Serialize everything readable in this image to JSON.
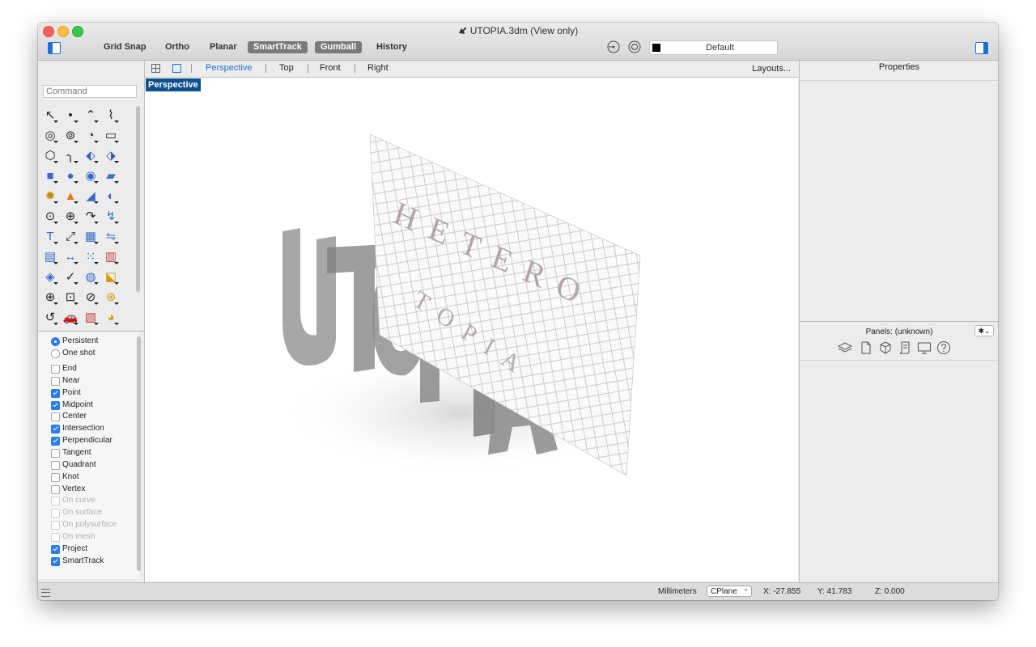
{
  "window": {
    "title": "UTOPIA.3dm (View only)"
  },
  "toolbar": {
    "modes": [
      {
        "label": "Grid Snap",
        "on": false
      },
      {
        "label": "Ortho",
        "on": false
      },
      {
        "label": "Planar",
        "on": false
      },
      {
        "label": "SmartTrack",
        "on": true
      },
      {
        "label": "Gumball",
        "on": true
      },
      {
        "label": "History",
        "on": false
      }
    ],
    "layer": "Default",
    "layer_color": "#000000"
  },
  "command": {
    "placeholder": "Command"
  },
  "tools": [
    "select-arrow-icon",
    "point-icon",
    "polyline-icon",
    "curve-icon",
    "circle-icon",
    "ellipse-icon",
    "arc-icon",
    "rectangle-icon",
    "polygon-icon",
    "fillet-curve-icon",
    "surface-from-points-icon",
    "sweep-surface-icon",
    "box-solid-icon",
    "sphere-icon",
    "cylinder-icon",
    "extrude-surface-icon",
    "gear-settings-icon",
    "trim-icon",
    "split-icon",
    "boolean-icon",
    "group-icon",
    "join-icon",
    "rebuild-icon",
    "edit-points-icon",
    "text-icon",
    "scale-icon",
    "array-icon",
    "mirror-icon",
    "block-icon",
    "dimension-icon",
    "grid-array-icon",
    "properties-icon",
    "render-icon",
    "check-icon",
    "analyze-icon",
    "paint-icon",
    "zoom-icon",
    "zoom-window-icon",
    "zoom-extents-icon",
    "zoom-selected-icon",
    "rotate-view-icon",
    "car-icon",
    "layout-icon",
    "shaded-icon"
  ],
  "osnaps": {
    "modes": [
      {
        "label": "Persistent",
        "selected": true
      },
      {
        "label": "One shot",
        "selected": false
      }
    ],
    "items": [
      {
        "label": "End",
        "checked": false,
        "enabled": true
      },
      {
        "label": "Near",
        "checked": false,
        "enabled": true
      },
      {
        "label": "Point",
        "checked": true,
        "enabled": true
      },
      {
        "label": "Midpoint",
        "checked": true,
        "enabled": true
      },
      {
        "label": "Center",
        "checked": false,
        "enabled": true
      },
      {
        "label": "Intersection",
        "checked": true,
        "enabled": true
      },
      {
        "label": "Perpendicular",
        "checked": true,
        "enabled": true
      },
      {
        "label": "Tangent",
        "checked": false,
        "enabled": true
      },
      {
        "label": "Quadrant",
        "checked": false,
        "enabled": true
      },
      {
        "label": "Knot",
        "checked": false,
        "enabled": true
      },
      {
        "label": "Vertex",
        "checked": false,
        "enabled": true
      },
      {
        "label": "On curve",
        "checked": false,
        "enabled": false
      },
      {
        "label": "On surface",
        "checked": false,
        "enabled": false
      },
      {
        "label": "On polysurface",
        "checked": false,
        "enabled": false
      },
      {
        "label": "On mesh",
        "checked": false,
        "enabled": false
      },
      {
        "label": "Project",
        "checked": true,
        "enabled": true
      },
      {
        "label": "SmartTrack",
        "checked": true,
        "enabled": true
      }
    ]
  },
  "viewports": {
    "tabs": [
      "Perspective",
      "Top",
      "Front",
      "Right"
    ],
    "active": "Perspective",
    "layouts_label": "Layouts...",
    "viewport_label": "Perspective"
  },
  "scene": {
    "text_3d": "UTOPIA",
    "plane_text": "HETERO",
    "plane_text2": "TOPIA"
  },
  "properties": {
    "title": "Properties",
    "panels_label": "Panels: (unknown)",
    "gear_label": "✱⌄",
    "panel_icons": [
      "layers-icon",
      "document-icon",
      "object-cube-icon",
      "notes-scroll-icon",
      "display-monitor-icon",
      "help-icon"
    ]
  },
  "status": {
    "units": "Millimeters",
    "cplane": "CPlane",
    "x": "X: -27.855",
    "y": "Y: 41.783",
    "z": "Z: 0.000"
  }
}
